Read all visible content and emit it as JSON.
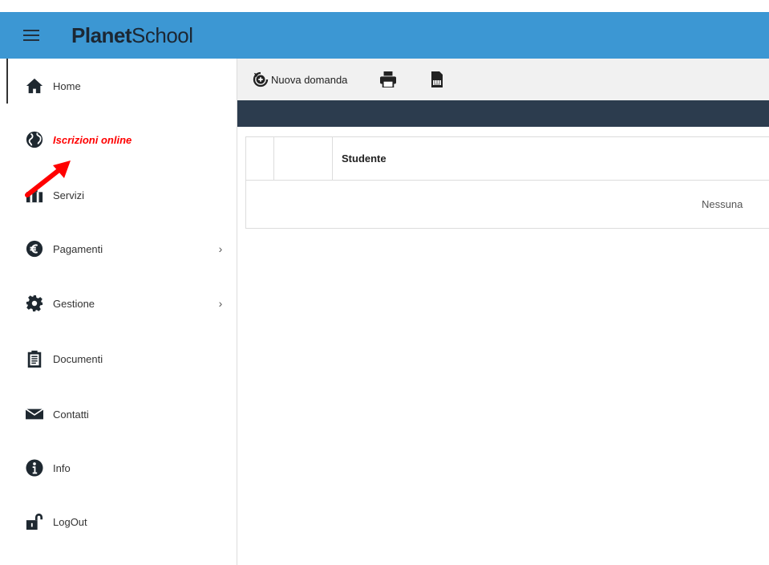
{
  "header": {
    "brand_bold": "Planet",
    "brand_regular": "School"
  },
  "sidebar": {
    "items": [
      {
        "label": "Home",
        "icon": "home-icon"
      },
      {
        "label": "Iscrizioni online",
        "icon": "globe-icon"
      },
      {
        "label": "Servizi",
        "icon": "services-icon"
      },
      {
        "label": "Pagamenti",
        "icon": "euro-icon",
        "chevron": "›"
      },
      {
        "label": "Gestione",
        "icon": "gear-icon",
        "chevron": "›"
      },
      {
        "label": "Documenti",
        "icon": "clipboard-icon"
      },
      {
        "label": "Contatti",
        "icon": "envelope-icon"
      },
      {
        "label": "Info",
        "icon": "info-icon"
      },
      {
        "label": "LogOut",
        "icon": "unlock-icon"
      }
    ]
  },
  "toolbar": {
    "new_label": "Nuova domanda"
  },
  "table": {
    "columns": [
      "",
      "",
      "Studente"
    ],
    "empty_text": "Nessuna"
  },
  "colors": {
    "topbar": "#3c97d3",
    "darkbar": "#2c3c4e",
    "highlight": "#ff0000"
  }
}
